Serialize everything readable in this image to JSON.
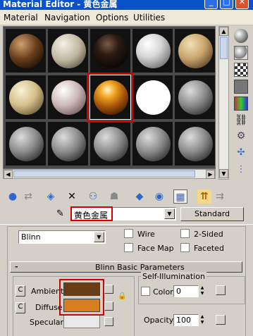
{
  "title": "Material Editor - 黄色金属",
  "window_controls": {
    "minimize": "_",
    "maximize": "□",
    "close": "✕"
  },
  "menu": [
    "Material",
    "Navigation",
    "Options",
    "Utilities"
  ],
  "sample_slots": [
    {
      "material": "brown-dark"
    },
    {
      "material": "beige-stone"
    },
    {
      "material": "black-glossy"
    },
    {
      "material": "white-glossy"
    },
    {
      "material": "tan-spotted"
    },
    {
      "material": "cream-spotted"
    },
    {
      "material": "white-marble"
    },
    {
      "material": "orange-metal",
      "selected": true
    },
    {
      "material": "pure-white"
    },
    {
      "material": "default-gray"
    },
    {
      "material": "default-gray"
    },
    {
      "material": "default-gray"
    },
    {
      "material": "default-gray"
    },
    {
      "material": "default-gray"
    },
    {
      "material": "default-gray"
    }
  ],
  "material_name": "黄色金属",
  "material_type_button": "Standard",
  "shader": {
    "type": "Blinn",
    "wire_label": "Wire",
    "two_sided_label": "2-Sided",
    "face_map_label": "Face Map",
    "faceted_label": "Faceted"
  },
  "rollout_title": "Blinn Basic Parameters",
  "rollout_toggle": "-",
  "colors": {
    "ambient_label": "Ambient:",
    "diffuse_label": "Diffuse:",
    "specular_label": "Specular:",
    "ambient": "#6b3d14",
    "diffuse": "#d67e20",
    "specular": "#e8e8e8",
    "highlight": "#d40000",
    "selection": "#0a52c9"
  },
  "lock_icon": "C",
  "self_illumination": {
    "title": "Self-Illumination",
    "color_label": "Color",
    "value": "0"
  },
  "opacity": {
    "label": "Opacity:",
    "value": "100"
  }
}
